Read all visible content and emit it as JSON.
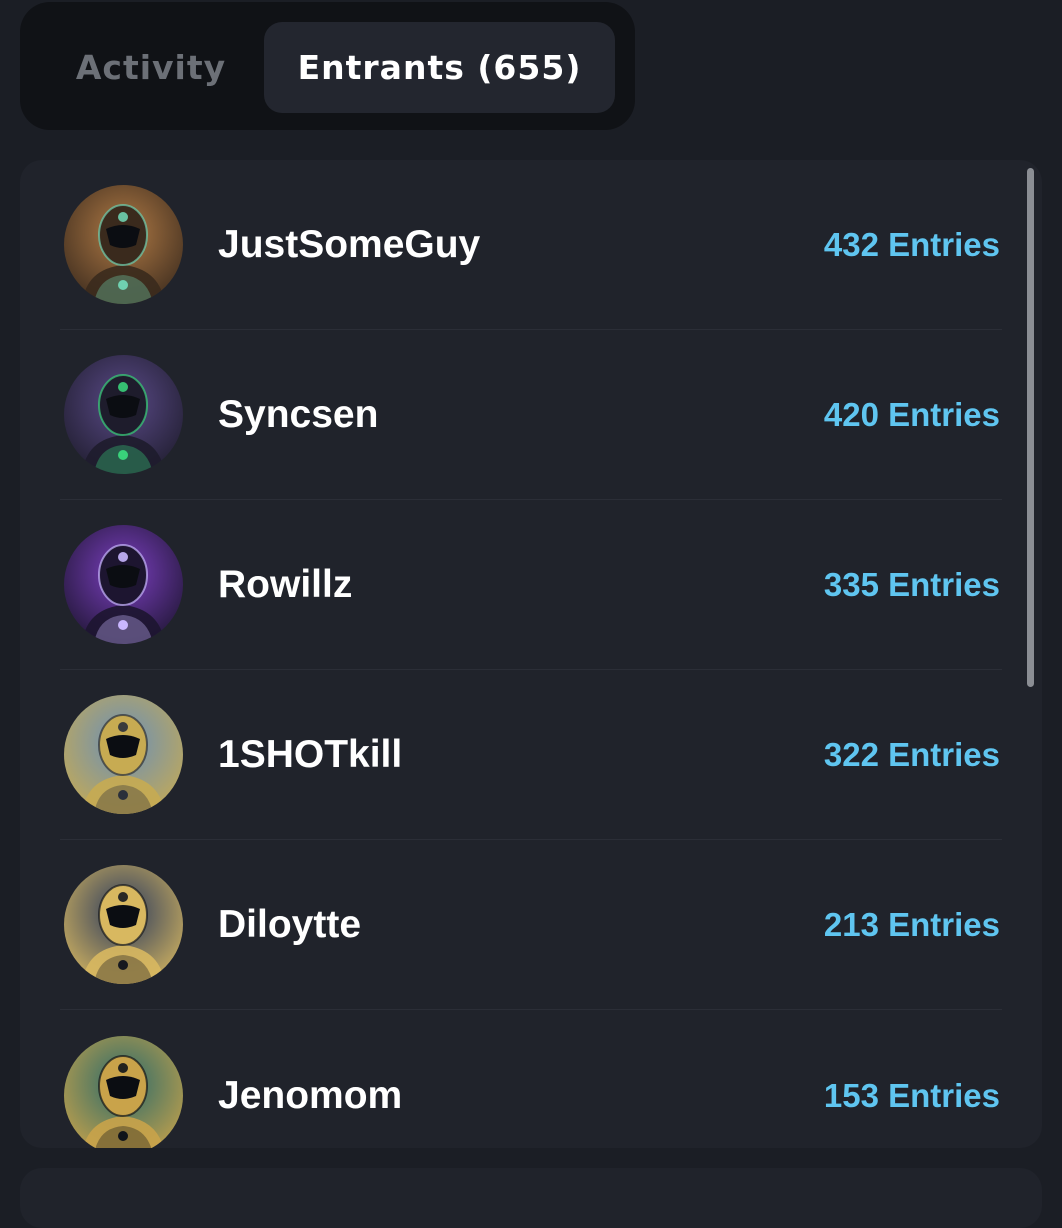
{
  "tabs": {
    "activity": "Activity",
    "entrants": "Entrants (655)",
    "active": "entrants"
  },
  "entrants": [
    {
      "name": "JustSomeGuy",
      "entries": "432 Entries",
      "avatar_colors": [
        "#b07a45",
        "#3a2a1d",
        "#6fd0b0"
      ]
    },
    {
      "name": "Syncsen",
      "entries": "420 Entries",
      "avatar_colors": [
        "#5a4a88",
        "#1e1c2c",
        "#39d27a"
      ]
    },
    {
      "name": "Rowillz",
      "entries": "335 Entries",
      "avatar_colors": [
        "#7b3fc0",
        "#1d1530",
        "#c9b6ff"
      ]
    },
    {
      "name": "1SHOTkill",
      "entries": "322 Entries",
      "avatar_colors": [
        "#6a8fb8",
        "#c7ab52",
        "#2a2f3a"
      ]
    },
    {
      "name": "Diloytte",
      "entries": "213 Entries",
      "avatar_colors": [
        "#2b3a5c",
        "#d8b860",
        "#16181f"
      ]
    },
    {
      "name": "Jenomom",
      "entries": "153 Entries",
      "avatar_colors": [
        "#2a6a6a",
        "#c9a34a",
        "#10141a"
      ]
    }
  ],
  "colors": {
    "background": "#1b1e25",
    "panel": "#20232b",
    "accent": "#5fc5f0",
    "text": "#ffffff",
    "muted": "#6c7077"
  }
}
